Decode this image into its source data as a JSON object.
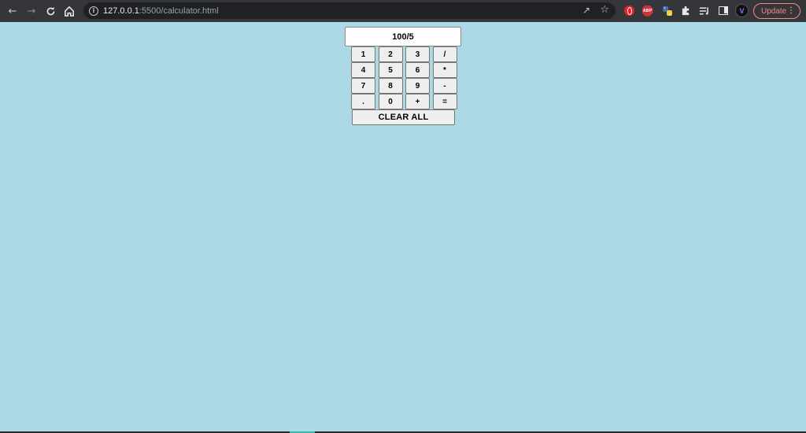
{
  "browser": {
    "url_host": "127.0.0.1",
    "url_path": ":5500/calculator.html",
    "update_label": "Update",
    "extensions": [
      "opera-icon",
      "adblock-plus-icon",
      "python-icon",
      "puzzle-icon",
      "reading-list-icon",
      "side-panel-icon"
    ],
    "abp_text": "ABP"
  },
  "calculator": {
    "display_value": "100/5",
    "keys": [
      "1",
      "2",
      "3",
      "/",
      "4",
      "5",
      "6",
      "*",
      "7",
      "8",
      "9",
      "-",
      ".",
      "0",
      "+",
      "="
    ],
    "clear_label": "CLEAR ALL"
  },
  "colors": {
    "page_background": "#add8e6",
    "chrome_background": "#35363a",
    "update_accent": "#f28b82"
  }
}
